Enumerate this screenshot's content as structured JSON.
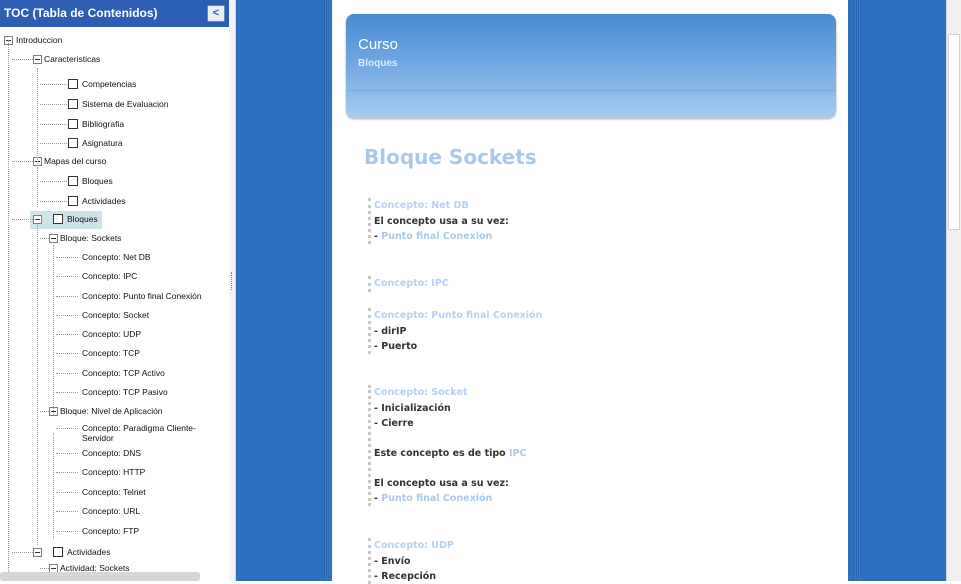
{
  "toc": {
    "title": "TOC (Tabla de Contenidos)",
    "collapse_glyph": "<",
    "items": [
      {
        "label": "Introduccion",
        "level": 0,
        "expander": true,
        "checkbox": false
      },
      {
        "label": "Caracteristicas",
        "level": 1,
        "expander": true,
        "checkbox": false
      },
      {
        "label": "Competencias",
        "level": 2,
        "expander": false,
        "checkbox": true
      },
      {
        "label": "Sistema de Evaluacion",
        "level": 2,
        "expander": false,
        "checkbox": true
      },
      {
        "label": "Bibliografia",
        "level": 2,
        "expander": false,
        "checkbox": true
      },
      {
        "label": "Asignatura",
        "level": 2,
        "expander": false,
        "checkbox": true
      },
      {
        "label": "Mapas del curso",
        "level": 1,
        "expander": true,
        "checkbox": false
      },
      {
        "label": "Bloques",
        "level": 2,
        "expander": false,
        "checkbox": true
      },
      {
        "label": "Actividades",
        "level": 2,
        "expander": false,
        "checkbox": true
      },
      {
        "label": "Bloques",
        "level": 1,
        "expander": true,
        "checkbox": true,
        "selected": true
      },
      {
        "label": "Bloque: Sockets",
        "level": 2,
        "expander": true,
        "checkbox": false
      },
      {
        "label": "Concepto: Net DB",
        "level": 3,
        "expander": false,
        "checkbox": false
      },
      {
        "label": "Concepto: IPC",
        "level": 3,
        "expander": false,
        "checkbox": false
      },
      {
        "label": "Concepto: Punto final Conexión",
        "level": 3,
        "expander": false,
        "checkbox": false
      },
      {
        "label": "Concepto: Socket",
        "level": 3,
        "expander": false,
        "checkbox": false
      },
      {
        "label": "Concepto: UDP",
        "level": 3,
        "expander": false,
        "checkbox": false
      },
      {
        "label": "Concepto: TCP",
        "level": 3,
        "expander": false,
        "checkbox": false
      },
      {
        "label": "Concepto: TCP Activo",
        "level": 3,
        "expander": false,
        "checkbox": false
      },
      {
        "label": "Concepto: TCP Pasivo",
        "level": 3,
        "expander": false,
        "checkbox": false
      },
      {
        "label": "Bloque: Nivel de Aplicación",
        "level": 2,
        "expander": true,
        "checkbox": false
      },
      {
        "label": "Concepto: Paradigma Cliente-",
        "label2": "Servidor",
        "level": 3,
        "expander": false,
        "checkbox": false
      },
      {
        "label": "Concepto: DNS",
        "level": 3,
        "expander": false,
        "checkbox": false
      },
      {
        "label": "Concepto: HTTP",
        "level": 3,
        "expander": false,
        "checkbox": false
      },
      {
        "label": "Concepto: Telnet",
        "level": 3,
        "expander": false,
        "checkbox": false
      },
      {
        "label": "Concepto: URL",
        "level": 3,
        "expander": false,
        "checkbox": false
      },
      {
        "label": "Concepto: FTP",
        "level": 3,
        "expander": false,
        "checkbox": false
      },
      {
        "label": "Actividades",
        "level": 1,
        "expander": true,
        "checkbox": true
      },
      {
        "label": "Actividad: Sockets",
        "level": 2,
        "expander": true,
        "checkbox": false
      }
    ]
  },
  "banner": {
    "title": "Curso",
    "subtitle": "Bloques"
  },
  "content": {
    "block_title": "Bloque Sockets",
    "concepts": [
      {
        "head": "Concepto: Net DB",
        "lines": [
          {
            "text": "El concepto usa a su vez:"
          },
          {
            "prefix": "- ",
            "link": "Punto final Conexion"
          }
        ]
      },
      {
        "head": "Concepto: IPC",
        "lines": []
      },
      {
        "head": "Concepto: Punto final Conexión",
        "lines": [
          {
            "text": "- dirIP"
          },
          {
            "text": "- Puerto"
          }
        ]
      },
      {
        "head": "Concepto: Socket",
        "lines": [
          {
            "text": "- Inicialización"
          },
          {
            "text": "- Cierre"
          },
          {
            "gap": true
          },
          {
            "text": "Este concepto es de tipo ",
            "link": "IPC"
          },
          {
            "gap": true
          },
          {
            "text": "El concepto usa a su vez:"
          },
          {
            "prefix": "- ",
            "link": "Punto final Conexión"
          }
        ]
      },
      {
        "head": "Concepto: UDP",
        "lines": [
          {
            "text": "- Envío"
          },
          {
            "text": "- Recepción"
          }
        ]
      }
    ]
  },
  "colors": {
    "toc_header_bg": "#2c5fb3",
    "main_bg": "#2d70c0",
    "heading_light_blue": "#aac8e8",
    "link_blue": "#a9c9ec",
    "selected_highlight": "#cfe3ea"
  }
}
